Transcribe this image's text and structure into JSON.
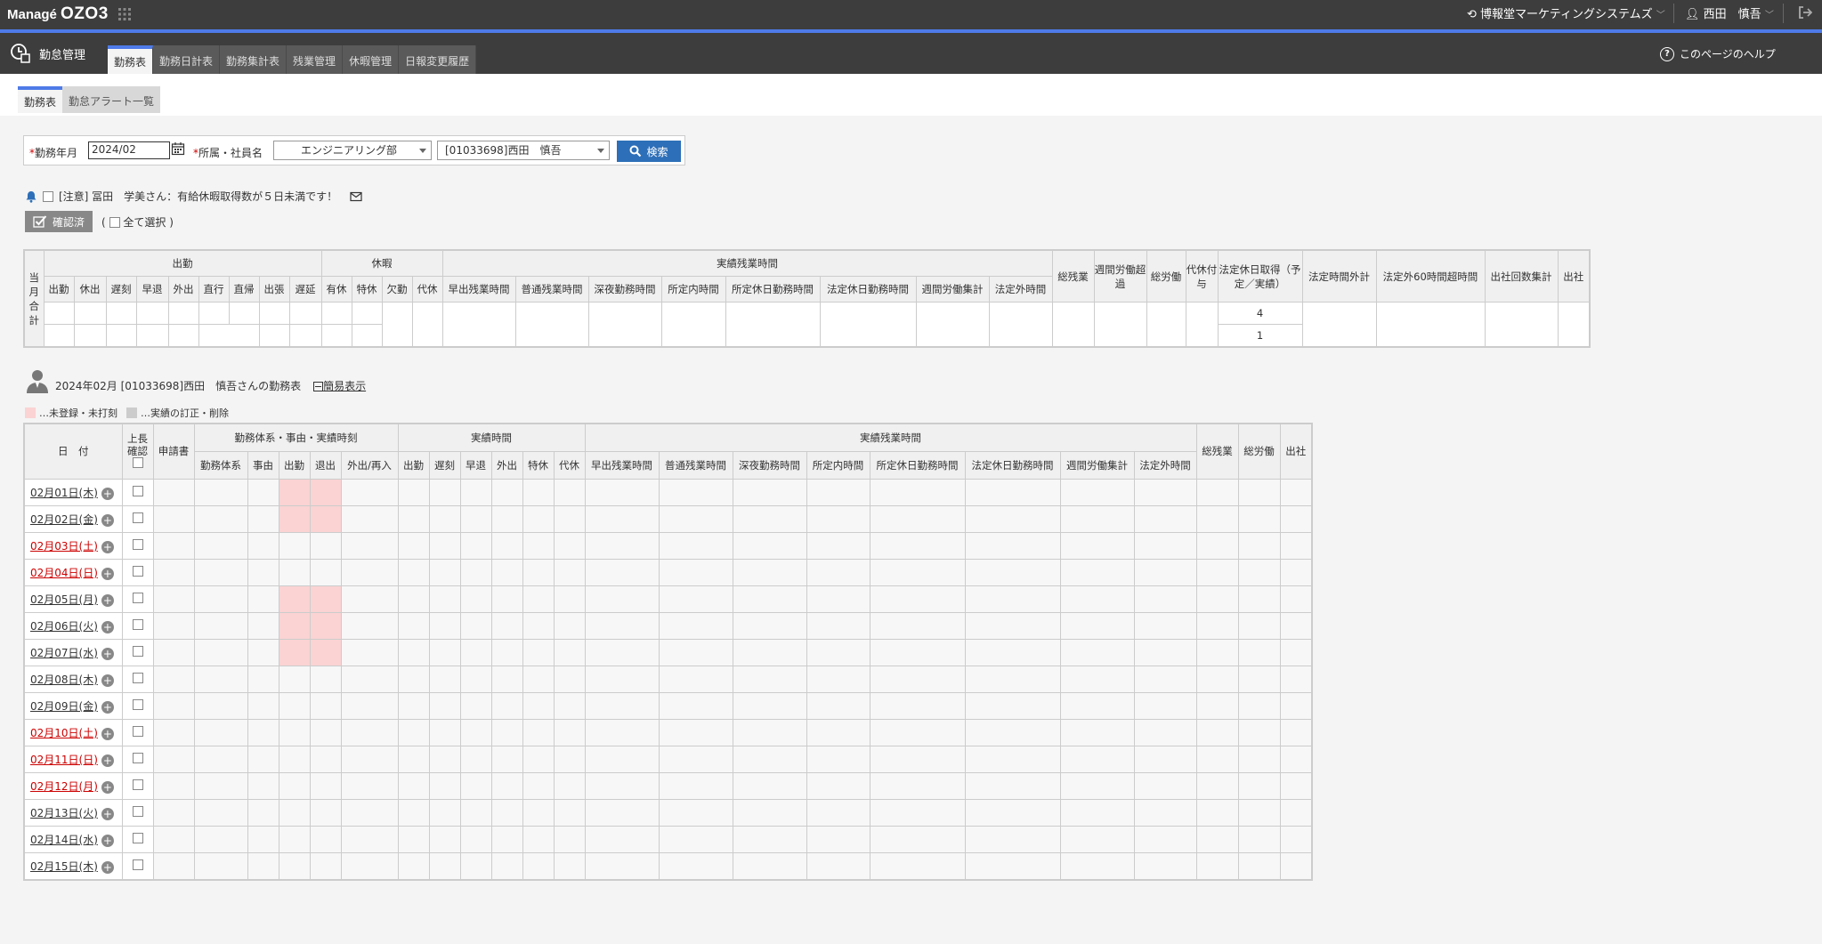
{
  "header": {
    "logo_small": "Managé",
    "logo_big": "OZO3",
    "company": "博報堂マーケティングシステムズ",
    "user": "西田　慎吾"
  },
  "module": {
    "title": "勤怠管理",
    "tabs": [
      "勤務表",
      "勤務日計表",
      "勤務集計表",
      "残業管理",
      "休暇管理",
      "日報変更履歴"
    ],
    "active_tab": 0,
    "help": "このページのヘルプ"
  },
  "subtabs": [
    "勤務表",
    "勤怠アラート一覧"
  ],
  "search": {
    "month_label": "勤務年月",
    "month_value": "2024/02",
    "dept_label": "所属・社員名",
    "dept_value": "エンジニアリング部",
    "employee_value": "[01033698]西田　慎吾",
    "search_button": "検索",
    "required_mark": "*"
  },
  "alert": {
    "text": "[注意] 冨田　学美さん：有給休暇取得数が５日未満です！"
  },
  "confirm": {
    "button": "確認済",
    "select_all": "全て選択",
    "paren_open": "(",
    "paren_close": ")"
  },
  "summary": {
    "row_label": "当月合計",
    "groups": {
      "attend": "出勤",
      "leave": "休暇",
      "overtime": "実績残業時間"
    },
    "attend_cols": [
      "出勤",
      "休出",
      "遅刻",
      "早退",
      "外出",
      "直行",
      "直帰",
      "出張",
      "遅延"
    ],
    "leave_cols": [
      "有休",
      "特休",
      "欠勤",
      "代休"
    ],
    "ot_cols": [
      "早出残業時間",
      "普通残業時間",
      "深夜勤務時間",
      "所定内時間",
      "所定休日勤務時間",
      "法定休日勤務時間",
      "週間労働集計",
      "法定外時間"
    ],
    "tail_cols": [
      "総残業",
      "週間労働超過",
      "総労働",
      "代休付与",
      "法定休日取得（予定／実績）",
      "法定時間外計",
      "法定外60時間超時間",
      "出社回数集計",
      "出社"
    ],
    "holiday_planned": "4",
    "holiday_actual": "1"
  },
  "person": {
    "title": "2024年02月 [01033698]西田　慎吾さんの勤務表",
    "simple": "簡易表示"
  },
  "legend": {
    "pink": "…未登録・未打刻",
    "gray": "…実績の訂正・削除"
  },
  "main": {
    "date_header": "日　付",
    "boss_header": "上長確認",
    "app_header": "申請書",
    "g1": "勤務体系・事由・実績時刻",
    "g2": "実績時間",
    "g3": "実績残業時間",
    "g1_cols": [
      "勤務体系",
      "事由",
      "出勤",
      "退出",
      "外出/再入"
    ],
    "g2_cols": [
      "出勤",
      "遅刻",
      "早退",
      "外出",
      "特休",
      "代休"
    ],
    "g3_cols": [
      "早出残業時間",
      "普通残業時間",
      "深夜勤務時間",
      "所定内時間",
      "所定休日勤務時間",
      "法定休日勤務時間",
      "週間労働集計",
      "法定外時間"
    ],
    "tail_cols": [
      "総残業",
      "総労働",
      "出社"
    ],
    "rows": [
      {
        "date": "02月01日(木)",
        "red": false,
        "pink": true
      },
      {
        "date": "02月02日(金)",
        "red": false,
        "pink": true
      },
      {
        "date": "02月03日(土)",
        "red": true,
        "pink": false
      },
      {
        "date": "02月04日(日)",
        "red": true,
        "pink": false
      },
      {
        "date": "02月05日(月)",
        "red": false,
        "pink": true
      },
      {
        "date": "02月06日(火)",
        "red": false,
        "pink": true
      },
      {
        "date": "02月07日(水)",
        "red": false,
        "pink": true
      },
      {
        "date": "02月08日(木)",
        "red": false,
        "pink": false
      },
      {
        "date": "02月09日(金)",
        "red": false,
        "pink": false
      },
      {
        "date": "02月10日(土)",
        "red": true,
        "pink": false
      },
      {
        "date": "02月11日(日)",
        "red": true,
        "pink": false
      },
      {
        "date": "02月12日(月)",
        "red": true,
        "pink": false
      },
      {
        "date": "02月13日(火)",
        "red": false,
        "pink": false
      },
      {
        "date": "02月14日(水)",
        "red": false,
        "pink": false
      },
      {
        "date": "02月15日(木)",
        "red": false,
        "pink": false
      }
    ]
  }
}
